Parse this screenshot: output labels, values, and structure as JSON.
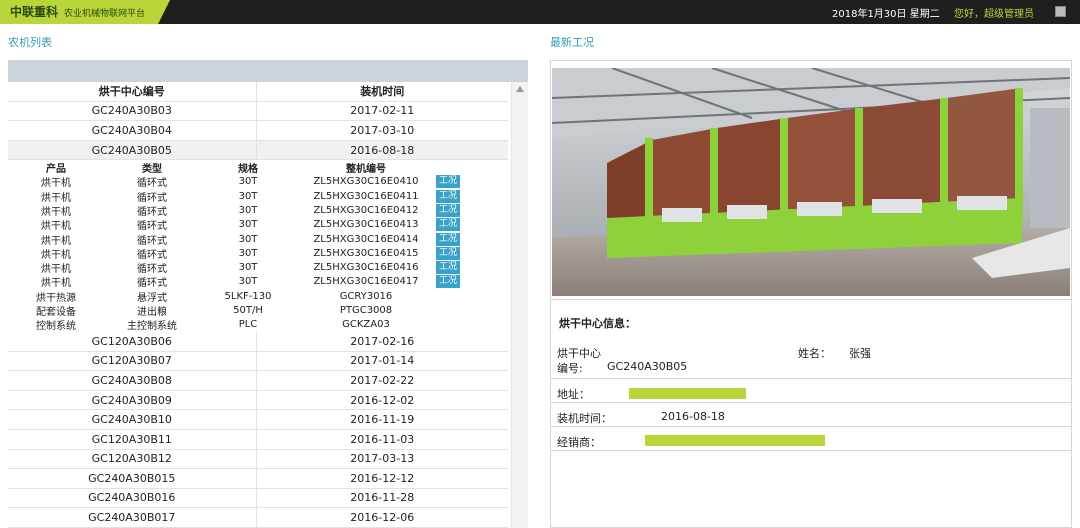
{
  "header": {
    "brand": "中联重科",
    "subtitle": "农业机械物联网平台",
    "date": "2018年1月30日 星期二",
    "greeting": "您好，超级管理员"
  },
  "left": {
    "title": "农机列表",
    "columns": [
      "烘干中心编号",
      "装机时间"
    ],
    "rows_top": [
      {
        "id": "GC240A30B03",
        "date": "2017-02-11"
      },
      {
        "id": "GC240A30B04",
        "date": "2017-03-10"
      },
      {
        "id": "GC240A30B05",
        "date": "2016-08-18"
      }
    ],
    "detail_columns": [
      "产品",
      "类型",
      "规格",
      "整机编号"
    ],
    "detail_rows": [
      {
        "p": "烘干机",
        "t": "循环式",
        "s": "30T",
        "n": "ZL5HXG30C16E0410",
        "btn": "工况"
      },
      {
        "p": "烘干机",
        "t": "循环式",
        "s": "30T",
        "n": "ZL5HXG30C16E0411",
        "btn": "工况"
      },
      {
        "p": "烘干机",
        "t": "循环式",
        "s": "30T",
        "n": "ZL5HXG30C16E0412",
        "btn": "工况"
      },
      {
        "p": "烘干机",
        "t": "循环式",
        "s": "30T",
        "n": "ZL5HXG30C16E0413",
        "btn": "工况"
      },
      {
        "p": "烘干机",
        "t": "循环式",
        "s": "30T",
        "n": "ZL5HXG30C16E0414",
        "btn": "工况"
      },
      {
        "p": "烘干机",
        "t": "循环式",
        "s": "30T",
        "n": "ZL5HXG30C16E0415",
        "btn": "工况"
      },
      {
        "p": "烘干机",
        "t": "循环式",
        "s": "30T",
        "n": "ZL5HXG30C16E0416",
        "btn": "工况"
      },
      {
        "p": "烘干机",
        "t": "循环式",
        "s": "30T",
        "n": "ZL5HXG30C16E0417",
        "btn": "工况"
      },
      {
        "p": "烘干热源",
        "t": "悬浮式",
        "s": "5LKF-130",
        "n": "GCRY3016",
        "btn": ""
      },
      {
        "p": "配套设备",
        "t": "进出粮",
        "s": "50T/H",
        "n": "PTGC3008",
        "btn": ""
      },
      {
        "p": "控制系统",
        "t": "主控制系统",
        "s": "PLC",
        "n": "GCKZA03",
        "btn": ""
      }
    ],
    "rows_bottom": [
      {
        "id": "GC120A30B06",
        "date": "2017-02-16"
      },
      {
        "id": "GC120A30B07",
        "date": "2017-01-14"
      },
      {
        "id": "GC240A30B08",
        "date": "2017-02-22"
      },
      {
        "id": "GC240A30B09",
        "date": "2016-12-02"
      },
      {
        "id": "GC240A30B10",
        "date": "2016-11-19"
      },
      {
        "id": "GC120A30B11",
        "date": "2016-11-03"
      },
      {
        "id": "GC120A30B12",
        "date": "2017-03-13"
      },
      {
        "id": "GC240A30B015",
        "date": "2016-12-12"
      },
      {
        "id": "GC240A30B016",
        "date": "2016-11-28"
      },
      {
        "id": "GC240A30B017",
        "date": "2016-12-06"
      }
    ]
  },
  "right": {
    "title": "最新工况",
    "info_title": "烘干中心信息：",
    "center_label_1": "烘干中心",
    "center_label_2": "编号:",
    "center_value": "GC240A30B05",
    "name_label": "姓名：",
    "name_value": "张强",
    "address_label": "地址：",
    "install_label": "装机时间：",
    "install_value": "2016-08-18",
    "dealer_label": "经销商：",
    "highlight_color": "#b8d53a"
  }
}
